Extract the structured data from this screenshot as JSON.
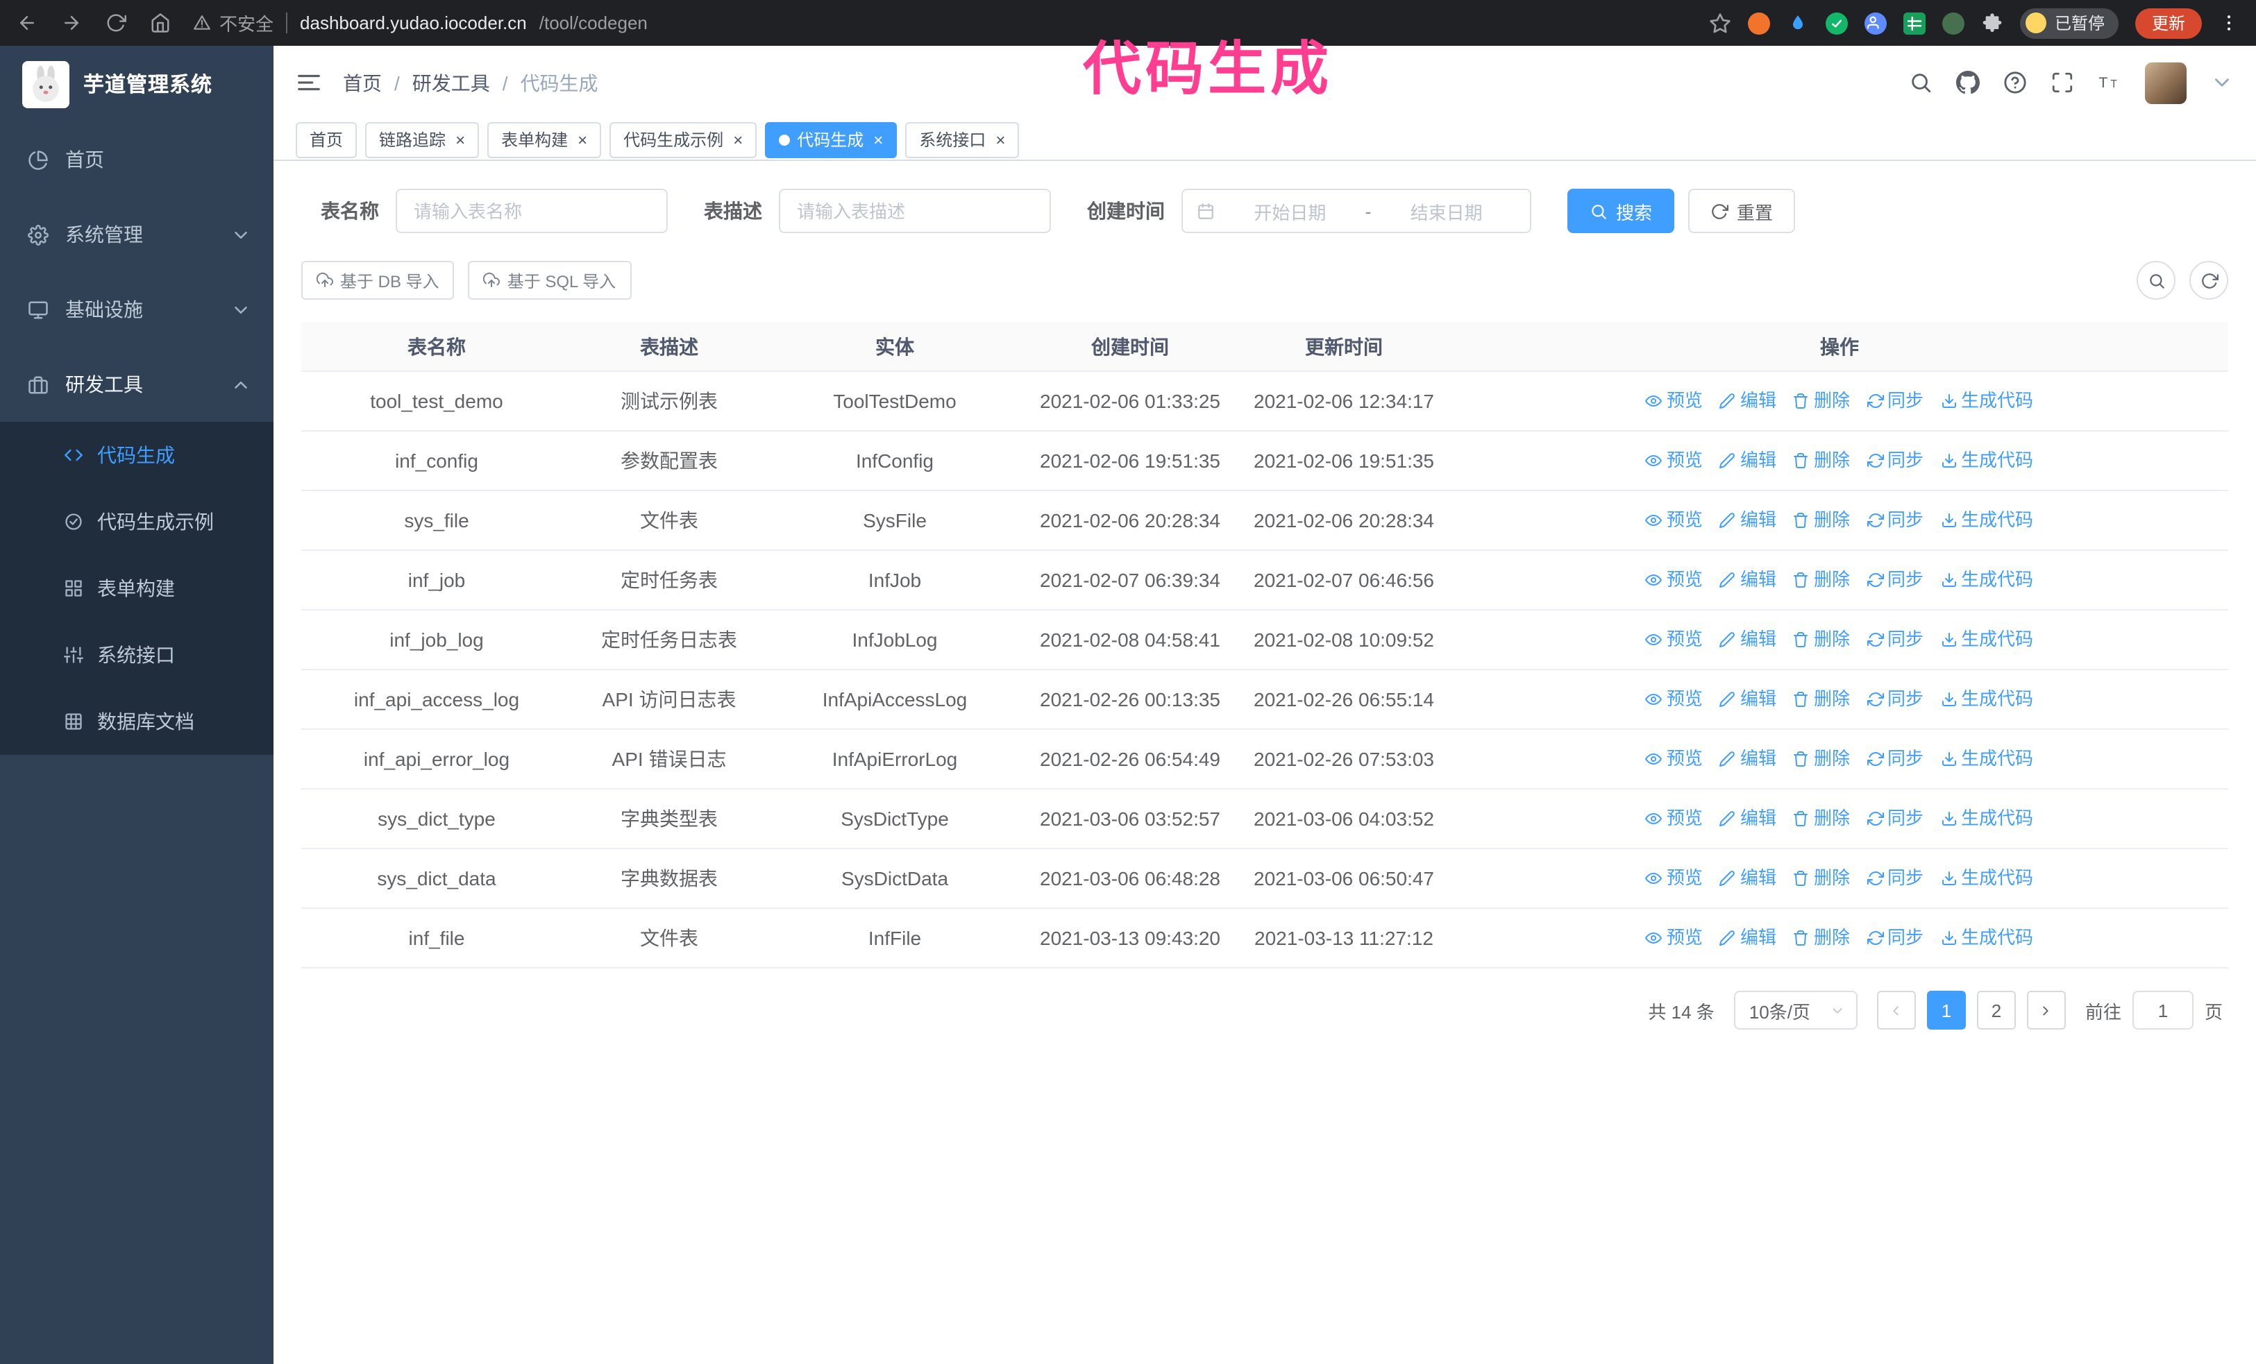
{
  "browser": {
    "security_warning": "不安全",
    "url_domain": "dashboard.yudao.iocoder.cn",
    "url_path": "/tool/codegen",
    "paused_badge": "已暂停",
    "update_button": "更新",
    "extensions": [
      {
        "name": "orange-extension-icon",
        "color": "#f2742c",
        "glyph": "none"
      },
      {
        "name": "drop-extension-icon",
        "color": "#3aa0ff",
        "glyph": "drop"
      },
      {
        "name": "check-extension-icon",
        "color": "#12b76a",
        "glyph": "check"
      },
      {
        "name": "users-extension-icon",
        "color": "#5e8bff",
        "glyph": "users"
      },
      {
        "name": "grid-extension-icon",
        "color": "#1a9e5c",
        "glyph": "grid"
      },
      {
        "name": "leaf-extension-icon",
        "color": "#47704e",
        "glyph": "none"
      }
    ]
  },
  "annotation": {
    "text": "代码生成",
    "color": "#ff3e92"
  },
  "sidebar": {
    "logo_title": "芋道管理系统",
    "items": [
      {
        "label": "首页",
        "icon": "dashboard",
        "key": "home"
      },
      {
        "label": "系统管理",
        "icon": "gear",
        "chevron": "down",
        "key": "system"
      },
      {
        "label": "基础设施",
        "icon": "monitor",
        "chevron": "down",
        "key": "infra"
      },
      {
        "label": "研发工具",
        "icon": "briefcase",
        "chevron": "up",
        "open": true,
        "key": "devtools",
        "children": [
          {
            "label": "代码生成",
            "icon": "code",
            "key": "codegen",
            "active": true
          },
          {
            "label": "代码生成示例",
            "icon": "badgecheck",
            "key": "codegen-example"
          },
          {
            "label": "表单构建",
            "icon": "formgrid",
            "key": "form-builder"
          },
          {
            "label": "系统接口",
            "icon": "sliders",
            "key": "system-api"
          },
          {
            "label": "数据库文档",
            "icon": "dbgrid",
            "key": "db-doc"
          }
        ]
      }
    ]
  },
  "header": {
    "breadcrumb": [
      "首页",
      "研发工具",
      "代码生成"
    ]
  },
  "tabs": [
    {
      "label": "首页",
      "closable": false
    },
    {
      "label": "链路追踪",
      "closable": true
    },
    {
      "label": "表单构建",
      "closable": true
    },
    {
      "label": "代码生成示例",
      "closable": true
    },
    {
      "label": "代码生成",
      "closable": true,
      "active": true
    },
    {
      "label": "系统接口",
      "closable": true
    }
  ],
  "filters": {
    "table_name_label": "表名称",
    "table_name_placeholder": "请输入表名称",
    "table_desc_label": "表描述",
    "table_desc_placeholder": "请输入表描述",
    "create_time_label": "创建时间",
    "date_start_placeholder": "开始日期",
    "date_separator": "-",
    "date_end_placeholder": "结束日期",
    "search_button": "搜索",
    "reset_button": "重置"
  },
  "toolbar": {
    "import_db": "基于 DB 导入",
    "import_sql": "基于 SQL 导入"
  },
  "table": {
    "columns": [
      "表名称",
      "表描述",
      "实体",
      "创建时间",
      "更新时间",
      "操作"
    ],
    "actions": [
      {
        "key": "preview",
        "label": "预览",
        "icon": "eye"
      },
      {
        "key": "edit",
        "label": "编辑",
        "icon": "edit"
      },
      {
        "key": "delete",
        "label": "删除",
        "icon": "trash"
      },
      {
        "key": "sync",
        "label": "同步",
        "icon": "sync"
      },
      {
        "key": "generate",
        "label": "生成代码",
        "icon": "download"
      }
    ],
    "rows": [
      {
        "name": "tool_test_demo",
        "desc": "测试示例表",
        "entity": "ToolTestDemo",
        "created": "2021-02-06 01:33:25",
        "updated": "2021-02-06 12:34:17"
      },
      {
        "name": "inf_config",
        "desc": "参数配置表",
        "entity": "InfConfig",
        "created": "2021-02-06 19:51:35",
        "updated": "2021-02-06 19:51:35"
      },
      {
        "name": "sys_file",
        "desc": "文件表",
        "entity": "SysFile",
        "created": "2021-02-06 20:28:34",
        "updated": "2021-02-06 20:28:34"
      },
      {
        "name": "inf_job",
        "desc": "定时任务表",
        "entity": "InfJob",
        "created": "2021-02-07 06:39:34",
        "updated": "2021-02-07 06:46:56"
      },
      {
        "name": "inf_job_log",
        "desc": "定时任务日志表",
        "entity": "InfJobLog",
        "created": "2021-02-08 04:58:41",
        "updated": "2021-02-08 10:09:52"
      },
      {
        "name": "inf_api_access_log",
        "desc": "API 访问日志表",
        "entity": "InfApiAccessLog",
        "created": "2021-02-26 00:13:35",
        "updated": "2021-02-26 06:55:14"
      },
      {
        "name": "inf_api_error_log",
        "desc": "API 错误日志",
        "entity": "InfApiErrorLog",
        "created": "2021-02-26 06:54:49",
        "updated": "2021-02-26 07:53:03"
      },
      {
        "name": "sys_dict_type",
        "desc": "字典类型表",
        "entity": "SysDictType",
        "created": "2021-03-06 03:52:57",
        "updated": "2021-03-06 04:03:52"
      },
      {
        "name": "sys_dict_data",
        "desc": "字典数据表",
        "entity": "SysDictData",
        "created": "2021-03-06 06:48:28",
        "updated": "2021-03-06 06:50:47"
      },
      {
        "name": "inf_file",
        "desc": "文件表",
        "entity": "InfFile",
        "created": "2021-03-13 09:43:20",
        "updated": "2021-03-13 11:27:12"
      }
    ]
  },
  "pagination": {
    "total_label": "共 14 条",
    "page_size": "10条/页",
    "pages": [
      "1",
      "2"
    ],
    "current": "1",
    "goto_label": "前往",
    "goto_value": "1",
    "goto_unit": "页"
  },
  "accent_color": "#409eff"
}
